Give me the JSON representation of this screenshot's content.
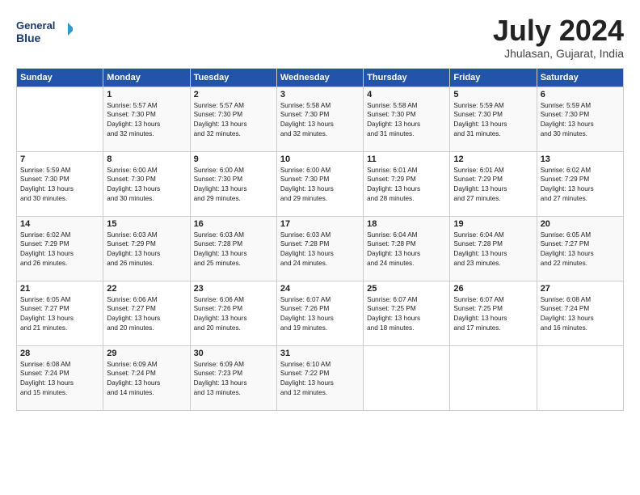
{
  "header": {
    "logo_line1": "General",
    "logo_line2": "Blue",
    "month": "July 2024",
    "location": "Jhulasan, Gujarat, India"
  },
  "days_of_week": [
    "Sunday",
    "Monday",
    "Tuesday",
    "Wednesday",
    "Thursday",
    "Friday",
    "Saturday"
  ],
  "weeks": [
    [
      {
        "day": "",
        "content": ""
      },
      {
        "day": "1",
        "content": "Sunrise: 5:57 AM\nSunset: 7:30 PM\nDaylight: 13 hours\nand 32 minutes."
      },
      {
        "day": "2",
        "content": "Sunrise: 5:57 AM\nSunset: 7:30 PM\nDaylight: 13 hours\nand 32 minutes."
      },
      {
        "day": "3",
        "content": "Sunrise: 5:58 AM\nSunset: 7:30 PM\nDaylight: 13 hours\nand 32 minutes."
      },
      {
        "day": "4",
        "content": "Sunrise: 5:58 AM\nSunset: 7:30 PM\nDaylight: 13 hours\nand 31 minutes."
      },
      {
        "day": "5",
        "content": "Sunrise: 5:59 AM\nSunset: 7:30 PM\nDaylight: 13 hours\nand 31 minutes."
      },
      {
        "day": "6",
        "content": "Sunrise: 5:59 AM\nSunset: 7:30 PM\nDaylight: 13 hours\nand 30 minutes."
      }
    ],
    [
      {
        "day": "7",
        "content": "Sunrise: 5:59 AM\nSunset: 7:30 PM\nDaylight: 13 hours\nand 30 minutes."
      },
      {
        "day": "8",
        "content": "Sunrise: 6:00 AM\nSunset: 7:30 PM\nDaylight: 13 hours\nand 30 minutes."
      },
      {
        "day": "9",
        "content": "Sunrise: 6:00 AM\nSunset: 7:30 PM\nDaylight: 13 hours\nand 29 minutes."
      },
      {
        "day": "10",
        "content": "Sunrise: 6:00 AM\nSunset: 7:30 PM\nDaylight: 13 hours\nand 29 minutes."
      },
      {
        "day": "11",
        "content": "Sunrise: 6:01 AM\nSunset: 7:29 PM\nDaylight: 13 hours\nand 28 minutes."
      },
      {
        "day": "12",
        "content": "Sunrise: 6:01 AM\nSunset: 7:29 PM\nDaylight: 13 hours\nand 27 minutes."
      },
      {
        "day": "13",
        "content": "Sunrise: 6:02 AM\nSunset: 7:29 PM\nDaylight: 13 hours\nand 27 minutes."
      }
    ],
    [
      {
        "day": "14",
        "content": "Sunrise: 6:02 AM\nSunset: 7:29 PM\nDaylight: 13 hours\nand 26 minutes."
      },
      {
        "day": "15",
        "content": "Sunrise: 6:03 AM\nSunset: 7:29 PM\nDaylight: 13 hours\nand 26 minutes."
      },
      {
        "day": "16",
        "content": "Sunrise: 6:03 AM\nSunset: 7:28 PM\nDaylight: 13 hours\nand 25 minutes."
      },
      {
        "day": "17",
        "content": "Sunrise: 6:03 AM\nSunset: 7:28 PM\nDaylight: 13 hours\nand 24 minutes."
      },
      {
        "day": "18",
        "content": "Sunrise: 6:04 AM\nSunset: 7:28 PM\nDaylight: 13 hours\nand 24 minutes."
      },
      {
        "day": "19",
        "content": "Sunrise: 6:04 AM\nSunset: 7:28 PM\nDaylight: 13 hours\nand 23 minutes."
      },
      {
        "day": "20",
        "content": "Sunrise: 6:05 AM\nSunset: 7:27 PM\nDaylight: 13 hours\nand 22 minutes."
      }
    ],
    [
      {
        "day": "21",
        "content": "Sunrise: 6:05 AM\nSunset: 7:27 PM\nDaylight: 13 hours\nand 21 minutes."
      },
      {
        "day": "22",
        "content": "Sunrise: 6:06 AM\nSunset: 7:27 PM\nDaylight: 13 hours\nand 20 minutes."
      },
      {
        "day": "23",
        "content": "Sunrise: 6:06 AM\nSunset: 7:26 PM\nDaylight: 13 hours\nand 20 minutes."
      },
      {
        "day": "24",
        "content": "Sunrise: 6:07 AM\nSunset: 7:26 PM\nDaylight: 13 hours\nand 19 minutes."
      },
      {
        "day": "25",
        "content": "Sunrise: 6:07 AM\nSunset: 7:25 PM\nDaylight: 13 hours\nand 18 minutes."
      },
      {
        "day": "26",
        "content": "Sunrise: 6:07 AM\nSunset: 7:25 PM\nDaylight: 13 hours\nand 17 minutes."
      },
      {
        "day": "27",
        "content": "Sunrise: 6:08 AM\nSunset: 7:24 PM\nDaylight: 13 hours\nand 16 minutes."
      }
    ],
    [
      {
        "day": "28",
        "content": "Sunrise: 6:08 AM\nSunset: 7:24 PM\nDaylight: 13 hours\nand 15 minutes."
      },
      {
        "day": "29",
        "content": "Sunrise: 6:09 AM\nSunset: 7:24 PM\nDaylight: 13 hours\nand 14 minutes."
      },
      {
        "day": "30",
        "content": "Sunrise: 6:09 AM\nSunset: 7:23 PM\nDaylight: 13 hours\nand 13 minutes."
      },
      {
        "day": "31",
        "content": "Sunrise: 6:10 AM\nSunset: 7:22 PM\nDaylight: 13 hours\nand 12 minutes."
      },
      {
        "day": "",
        "content": ""
      },
      {
        "day": "",
        "content": ""
      },
      {
        "day": "",
        "content": ""
      }
    ]
  ]
}
